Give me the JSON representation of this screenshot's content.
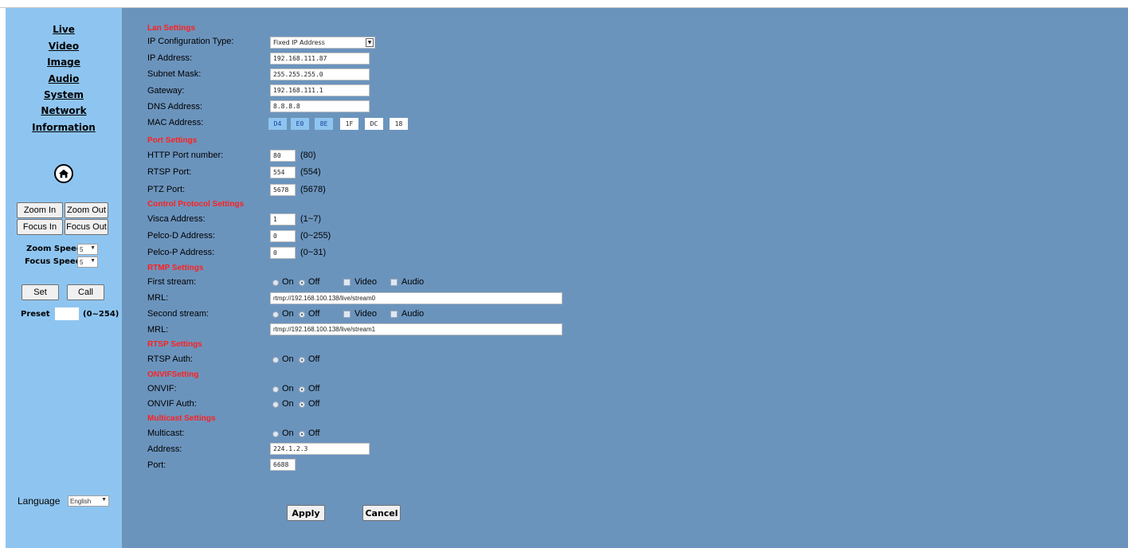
{
  "sidebar": {
    "nav": [
      "Live",
      "Video",
      "Image",
      "Audio",
      "System",
      "Network",
      "Information"
    ],
    "zoom_in": "Zoom In",
    "zoom_out": "Zoom Out",
    "focus_in": "Focus In",
    "focus_out": "Focus Out",
    "zoom_speed_label": "Zoom Speed",
    "zoom_speed_value": "5",
    "focus_speed_label": "Focus Speed",
    "focus_speed_value": "5",
    "set": "Set",
    "call": "Call",
    "preset_label": "Preset",
    "preset_value": "",
    "preset_range": "(0~254)",
    "language_label": "Language",
    "language_value": "English"
  },
  "lan": {
    "title": "Lan Settings",
    "ip_config_label": "IP Configuration Type:",
    "ip_config_value": "Fixed IP Address",
    "ip_label": "IP Address:",
    "ip_value": "192.168.111.87",
    "subnet_label": "Subnet Mask:",
    "subnet_value": "255.255.255.0",
    "gateway_label": "Gateway:",
    "gateway_value": "192.168.111.1",
    "dns_label": "DNS Address:",
    "dns_value": "8.8.8.8",
    "mac_label": "MAC Address:",
    "mac": [
      "D4",
      "E0",
      "8E",
      "1F",
      "DC",
      "18"
    ]
  },
  "port": {
    "title": "Port Settings",
    "http_label": "HTTP Port number:",
    "http_value": "80",
    "http_default": "(80)",
    "rtsp_label": "RTSP Port:",
    "rtsp_value": "554",
    "rtsp_default": "(554)",
    "ptz_label": "PTZ Port:",
    "ptz_value": "5678",
    "ptz_default": "(5678)"
  },
  "control": {
    "title": "Control Protocol Settings",
    "visca_label": "Visca Address:",
    "visca_value": "1",
    "visca_range": "(1~7)",
    "pelcod_label": "Pelco-D Address:",
    "pelcod_value": "0",
    "pelcod_range": "(0~255)",
    "pelcop_label": "Pelco-P Address:",
    "pelcop_value": "0",
    "pelcop_range": "(0~31)"
  },
  "rtmp": {
    "title": "RTMP Settings",
    "first_label": "First stream:",
    "on": "On",
    "off": "Off",
    "video": "Video",
    "audio": "Audio",
    "mrl_label": "MRL:",
    "first_mrl": "rtmp://192.168.100.138/live/stream0",
    "second_label": "Second stream:",
    "second_mrl": "rtmp://192.168.100.138/live/stream1"
  },
  "rtsp": {
    "title": "RTSP Settings",
    "auth_label": "RTSP Auth:"
  },
  "onvif": {
    "title": "ONVIFSetting",
    "onvif_label": "ONVIF:",
    "auth_label": "ONVIF Auth:"
  },
  "multicast": {
    "title": "Multicast Settings",
    "multicast_label": "Multicast:",
    "address_label": "Address:",
    "address_value": "224.1.2.3",
    "port_label": "Port:",
    "port_value": "6688"
  },
  "actions": {
    "apply": "Apply",
    "cancel": "Cancel"
  },
  "colors": {
    "sidebar_bg": "#8ec5f0",
    "main_bg": "#6b94bd",
    "section_title": "#ff2020"
  }
}
